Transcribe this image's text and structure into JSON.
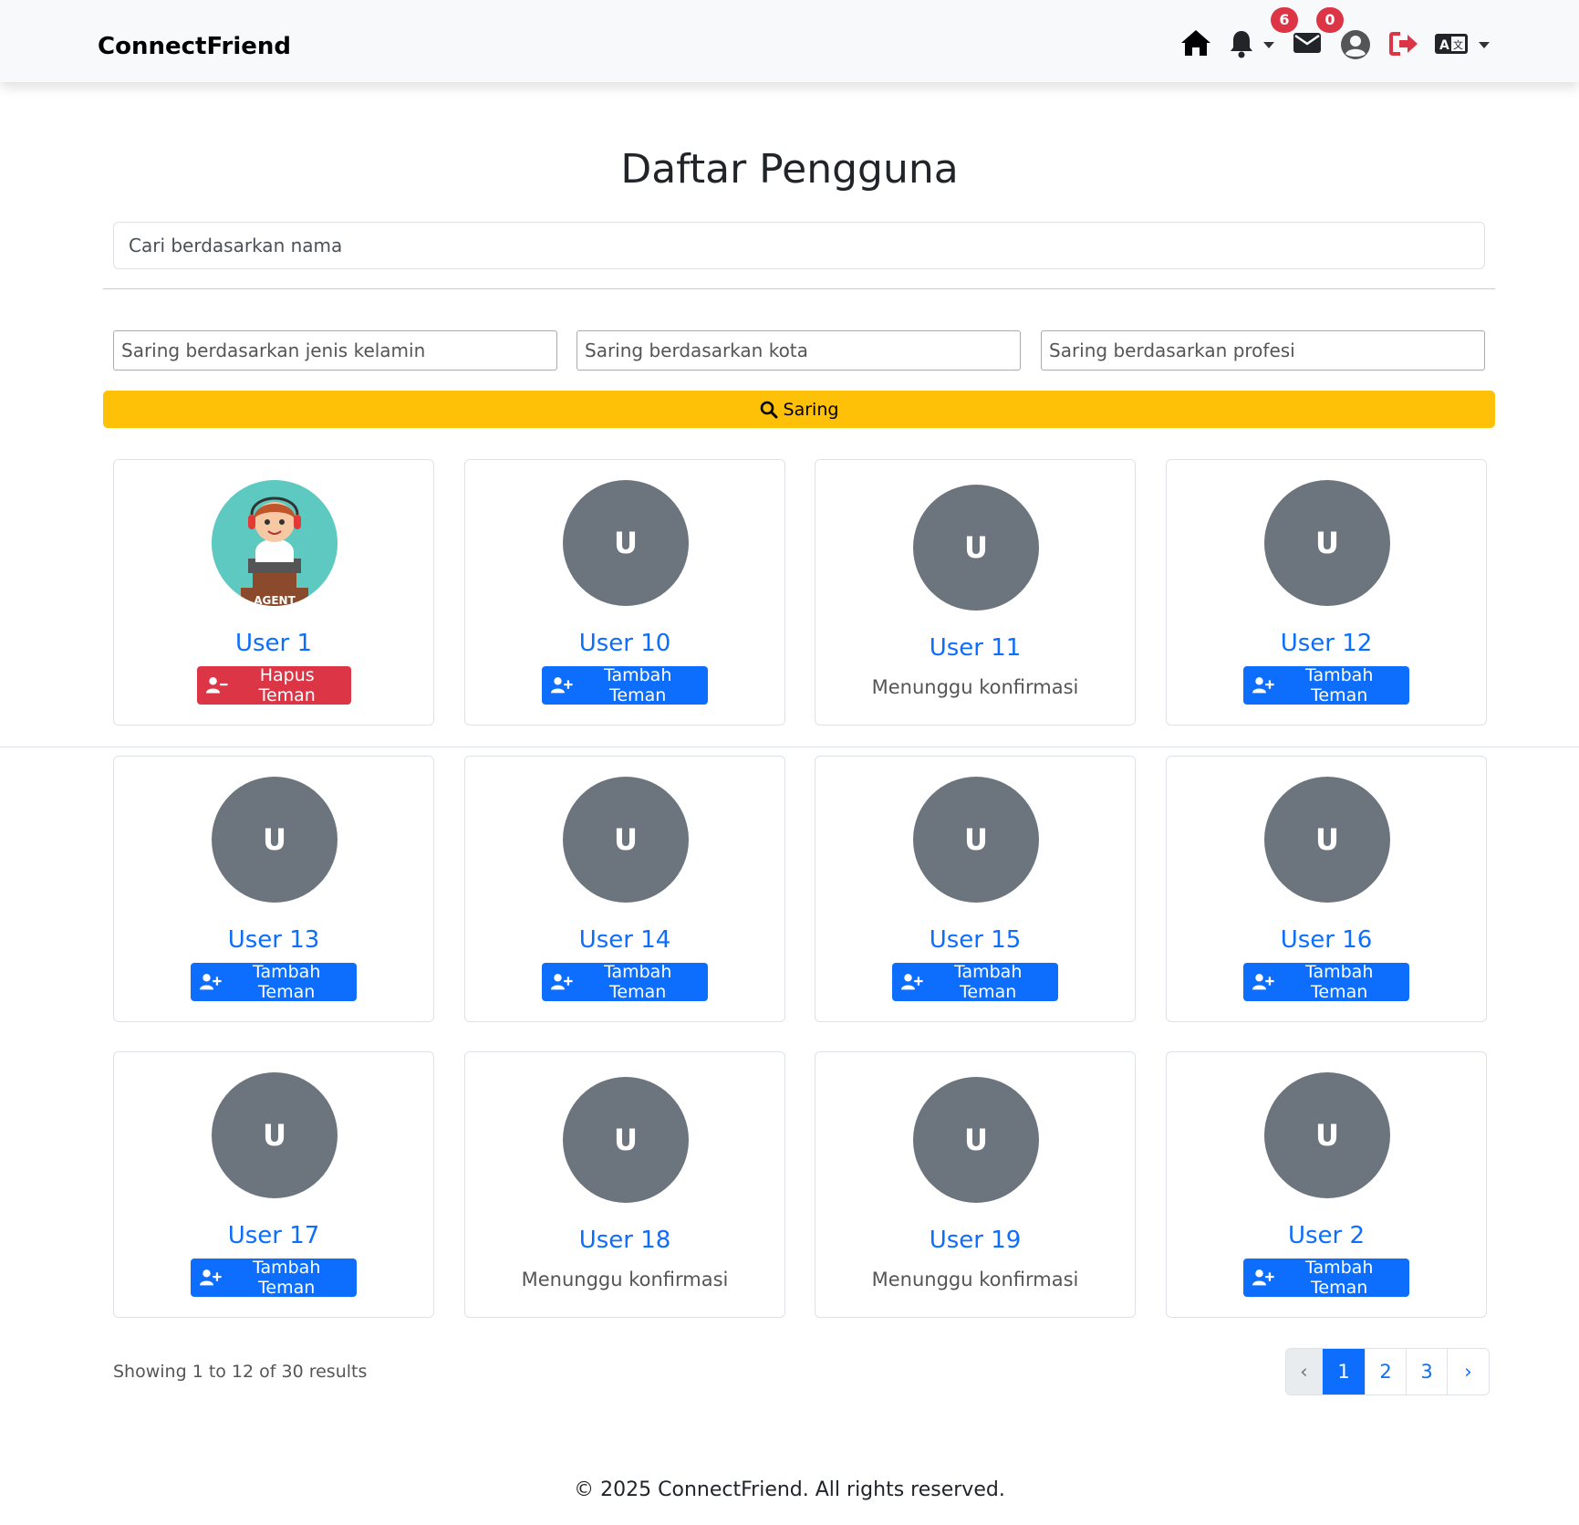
{
  "brand": "ConnectFriend",
  "nav": {
    "notification_count": "6",
    "message_count": "0"
  },
  "page_title": "Daftar Pengguna",
  "search": {
    "placeholder": "Cari berdasarkan nama"
  },
  "filters": {
    "gender_placeholder": "Saring berdasarkan jenis kelamin",
    "city_placeholder": "Saring berdasarkan kota",
    "profession_placeholder": "Saring berdasarkan profesi",
    "button_label": "Saring"
  },
  "users": [
    {
      "name": "User 1",
      "initial": "",
      "action": "Hapus Teman",
      "image": "agent-avatar"
    },
    {
      "name": "User 10",
      "initial": "U",
      "action": "Tambah Teman"
    },
    {
      "name": "User 11",
      "initial": "U",
      "status": "Menunggu konfirmasi"
    },
    {
      "name": "User 12",
      "initial": "U",
      "action": "Tambah Teman"
    },
    {
      "name": "User 13",
      "initial": "U",
      "action": "Tambah Teman"
    },
    {
      "name": "User 14",
      "initial": "U",
      "action": "Tambah Teman"
    },
    {
      "name": "User 15",
      "initial": "U",
      "action": "Tambah Teman"
    },
    {
      "name": "User 16",
      "initial": "U",
      "action": "Tambah Teman"
    },
    {
      "name": "User 17",
      "initial": "U",
      "action": "Tambah Teman"
    },
    {
      "name": "User 18",
      "initial": "U",
      "status": "Menunggu konfirmasi"
    },
    {
      "name": "User 19",
      "initial": "U",
      "status": "Menunggu konfirmasi"
    },
    {
      "name": "User 2",
      "initial": "U",
      "action": "Tambah Teman"
    }
  ],
  "avatar_image_text": "AGENT",
  "results_text": "Showing 1 to 12 of 30 results",
  "pagination": {
    "prev": "‹",
    "pages": [
      "1",
      "2",
      "3"
    ],
    "next": "›",
    "current": "1"
  },
  "footer": "© 2025 ConnectFriend. All rights reserved.",
  "colors": {
    "primary": "#0d6efd",
    "danger": "#dc3545",
    "warning": "#ffc107",
    "avatar_bg": "#6c757d"
  }
}
